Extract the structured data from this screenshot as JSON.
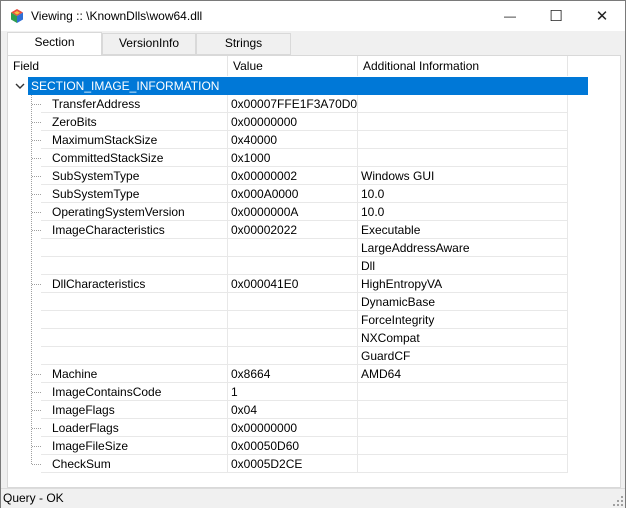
{
  "window": {
    "title": "Viewing :: \\KnownDlls\\wow64.dll"
  },
  "caption_buttons": {
    "minimize": "—",
    "maximize": "☐",
    "close": "✕"
  },
  "tabs": [
    {
      "label": "Section",
      "active": true
    },
    {
      "label": "VersionInfo",
      "active": false
    },
    {
      "label": "Strings",
      "active": false
    }
  ],
  "columns": {
    "field": "Field",
    "value": "Value",
    "info": "Additional Information"
  },
  "root": {
    "label": "SECTION_IMAGE_INFORMATION",
    "expander": "chevron-down-icon"
  },
  "rows": [
    {
      "field": "TransferAddress",
      "value": "0x00007FFE1F3A70D0",
      "info": ""
    },
    {
      "field": "ZeroBits",
      "value": "0x00000000",
      "info": ""
    },
    {
      "field": "MaximumStackSize",
      "value": "0x40000",
      "info": ""
    },
    {
      "field": "CommittedStackSize",
      "value": "0x1000",
      "info": ""
    },
    {
      "field": "SubSystemType",
      "value": "0x00000002",
      "info": "Windows GUI"
    },
    {
      "field": "SubSystemType",
      "value": "0x000A0000",
      "info": "10.0"
    },
    {
      "field": "OperatingSystemVersion",
      "value": "0x0000000A",
      "info": "10.0"
    },
    {
      "field": "ImageCharacteristics",
      "value": "0x00002022",
      "info": "Executable"
    },
    {
      "field": "",
      "value": "",
      "info": "LargeAddressAware"
    },
    {
      "field": "",
      "value": "",
      "info": "Dll"
    },
    {
      "field": "DllCharacteristics",
      "value": "0x000041E0",
      "info": "HighEntropyVA"
    },
    {
      "field": "",
      "value": "",
      "info": "DynamicBase"
    },
    {
      "field": "",
      "value": "",
      "info": "ForceIntegrity"
    },
    {
      "field": "",
      "value": "",
      "info": "NXCompat"
    },
    {
      "field": "",
      "value": "",
      "info": "GuardCF"
    },
    {
      "field": "Machine",
      "value": "0x8664",
      "info": "AMD64"
    },
    {
      "field": "ImageContainsCode",
      "value": "1",
      "info": ""
    },
    {
      "field": "ImageFlags",
      "value": "0x04",
      "info": ""
    },
    {
      "field": "LoaderFlags",
      "value": "0x00000000",
      "info": ""
    },
    {
      "field": "ImageFileSize",
      "value": "0x00050D60",
      "info": ""
    },
    {
      "field": "CheckSum",
      "value": "0x0005D2CE",
      "info": ""
    }
  ],
  "status": {
    "text": "Query - OK"
  },
  "colors": {
    "selection": "#0078d7",
    "panel": "#ffffff",
    "chrome": "#f0f0f0"
  }
}
